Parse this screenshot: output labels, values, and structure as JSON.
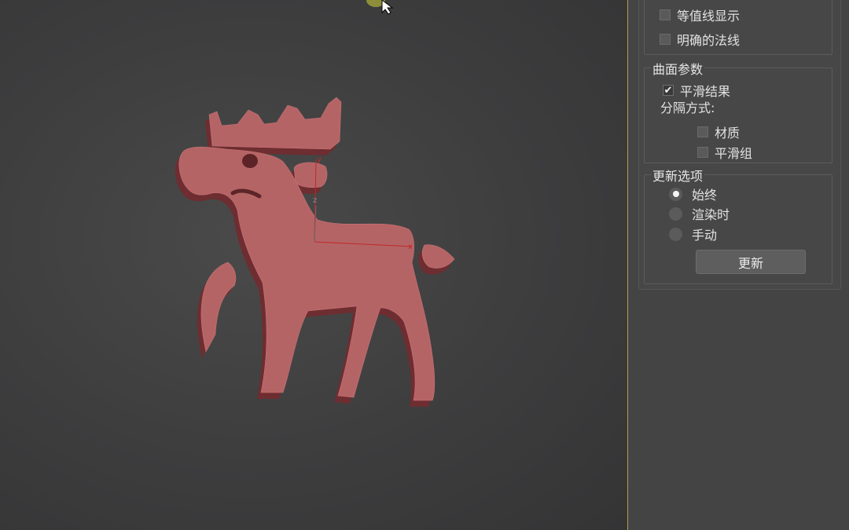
{
  "viewport": {
    "model_color": "#b56466",
    "gizmo_color": "#c0282a",
    "gizmo_labels": {
      "x": "x",
      "y": "y",
      "z": "z"
    }
  },
  "panel": {
    "top_checkboxes": [
      {
        "label": "等值线显示",
        "checked": false
      },
      {
        "label": "明确的法线",
        "checked": false
      }
    ],
    "surface_params": {
      "title": "曲面参数",
      "smooth_result": {
        "label": "平滑结果",
        "checked": true
      },
      "separate_by_label": "分隔方式:",
      "separate_options": [
        {
          "label": "材质",
          "checked": false
        },
        {
          "label": "平滑组",
          "checked": false
        }
      ]
    },
    "update_options": {
      "title": "更新选项",
      "radios": [
        {
          "label": "始终",
          "selected": true
        },
        {
          "label": "渲染时",
          "selected": false
        },
        {
          "label": "手动",
          "selected": false
        }
      ],
      "update_button": "更新"
    }
  }
}
